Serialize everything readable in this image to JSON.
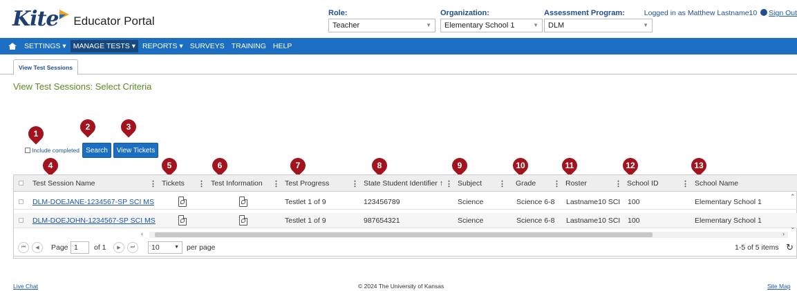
{
  "header": {
    "logo_text": "Kite",
    "portal_name": "Educator Portal",
    "role": {
      "label": "Role:",
      "value": "Teacher"
    },
    "organization": {
      "label": "Organization:",
      "value": "Elementary School 1"
    },
    "program": {
      "label": "Assessment Program:",
      "value": "DLM"
    },
    "logged_in": "Logged in as Matthew Lastname10",
    "sign_out": "Sign Out"
  },
  "nav": {
    "items": [
      "SETTINGS ▾",
      "MANAGE TESTS ▾",
      "REPORTS ▾",
      "SURVEYS",
      "TRAINING",
      "HELP"
    ]
  },
  "tabs": [
    "View Test Sessions"
  ],
  "page_title": "View Test Sessions: Select Criteria",
  "controls": {
    "include_completed": "Include completed",
    "search": "Search",
    "view_tickets": "View Tickets"
  },
  "markers": [
    "1",
    "2",
    "3",
    "4",
    "5",
    "6",
    "7",
    "8",
    "9",
    "10",
    "11",
    "12",
    "13"
  ],
  "table": {
    "columns": [
      "Test Session Name",
      "Tickets",
      "Test Information",
      "Test Progress",
      "State Student Identifier ↑",
      "Subject",
      "Grade",
      "Roster",
      "School ID",
      "School Name"
    ],
    "rows": [
      {
        "name": "DLM-DOEJANE-1234567-SP SCI MS",
        "progress": "Testlet 1 of 9",
        "ssid": "123456789",
        "subject": "Science",
        "grade": "Science 6-8",
        "roster": "Lastname10 SCI",
        "school_id": "100",
        "school_name": "Elementary School 1"
      },
      {
        "name": "DLM-DOEJOHN-1234567-SP SCI MS",
        "progress": "Testlet 1 of 9",
        "ssid": "987654321",
        "subject": "Science",
        "grade": "Science 6-8",
        "roster": "Lastname10 SCI",
        "school_id": "100",
        "school_name": "Elementary School 1"
      }
    ]
  },
  "pager": {
    "page_label": "Page",
    "page_value": "1",
    "of_label": "of 1",
    "per_page_value": "10",
    "per_page_label": "per page",
    "items_info": "1-5 of 5 items"
  },
  "footer": {
    "live_chat": "Live Chat",
    "copyright": "© 2024 The University of Kansas",
    "site_map": "Site Map"
  },
  "colors": {
    "nav_bg": "#1b6ec2",
    "marker": "#a3131e",
    "title_green": "#5a8a1f"
  }
}
